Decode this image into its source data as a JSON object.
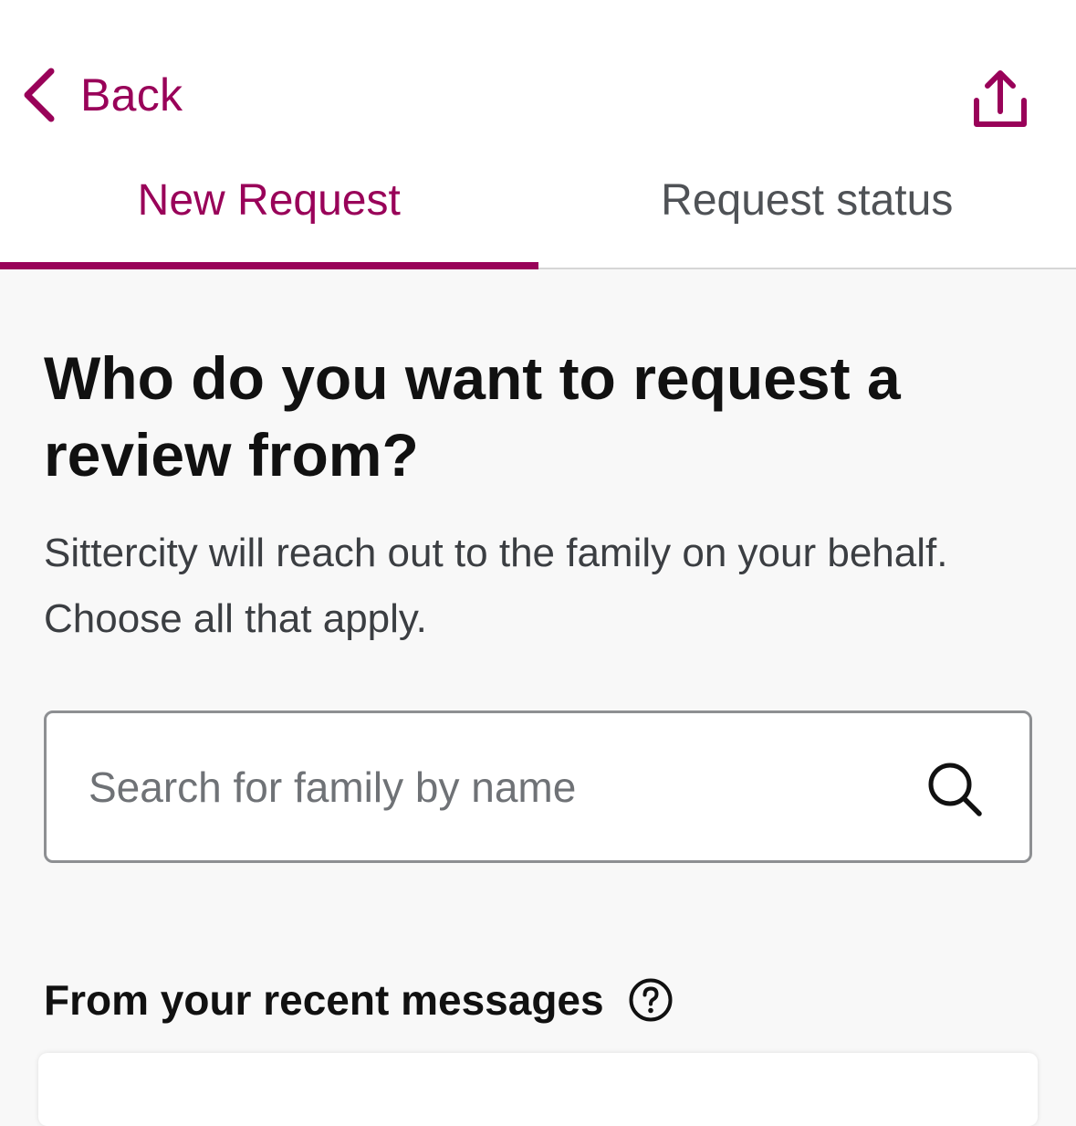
{
  "header": {
    "back_label": "Back",
    "share_icon": "share-icon",
    "back_icon": "chevron-left-icon"
  },
  "tabs": [
    {
      "label": "New Request",
      "active": true
    },
    {
      "label": "Request status",
      "active": false
    }
  ],
  "main": {
    "heading": "Who do you want to request a review from?",
    "subtext": "Sittercity will reach out to the family on your behalf. Choose all that apply.",
    "search": {
      "placeholder": "Search for family by name",
      "value": "",
      "icon": "search-icon"
    },
    "recent_section": {
      "title": "From your recent messages",
      "help_icon": "help-circle-icon"
    }
  },
  "colors": {
    "accent": "#990259",
    "background": "#f8f8f8",
    "text_primary": "#111111",
    "text_secondary": "#3b3e42"
  }
}
